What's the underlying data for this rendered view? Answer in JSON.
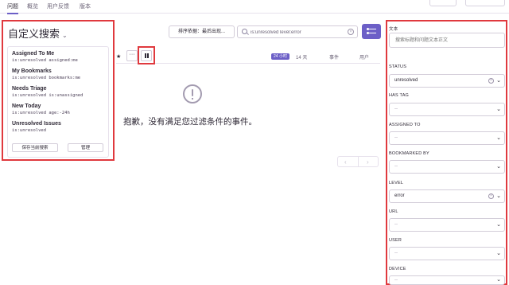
{
  "tabs": [
    {
      "label": "问题",
      "active": true
    },
    {
      "label": "概览",
      "active": false
    },
    {
      "label": "用户反馈",
      "active": false
    },
    {
      "label": "版本",
      "active": false
    }
  ],
  "saved_searches": {
    "title": "自定义搜索",
    "items": [
      {
        "name": "Assigned To Me",
        "query": "is:unresolved assigned:me"
      },
      {
        "name": "My Bookmarks",
        "query": "is:unresolved bookmarks:me"
      },
      {
        "name": "Needs Triage",
        "query": "is:unresolved is:unassigned"
      },
      {
        "name": "New Today",
        "query": "is:unresolved age:-24h"
      },
      {
        "name": "Unresolved Issues",
        "query": "is:unresolved"
      }
    ],
    "save_label": "保存当前搜索",
    "manage_label": "管理"
  },
  "toolbar": {
    "sort_label": "排序依据：最后出现...",
    "search_value": "is:unresolved level:error",
    "accent": "#6c5fc7"
  },
  "stream": {
    "period_label": "24 小时",
    "period_alt": "14 天",
    "col_events": "事件",
    "col_users": "用户",
    "empty_message": "抱歉，没有满足您过滤条件的事件。"
  },
  "sidebar": {
    "text_label": "文本",
    "text_placeholder": "搜索标题和问题文本正文",
    "filters": [
      {
        "label": "STATUS",
        "value": "unresolved",
        "clearable": true
      },
      {
        "label": "HAS TAG",
        "value": "--",
        "clearable": false
      },
      {
        "label": "ASSIGNED TO",
        "value": "--",
        "clearable": false
      },
      {
        "label": "BOOKMARKED BY",
        "value": "--",
        "clearable": false
      },
      {
        "label": "LEVEL",
        "value": "error",
        "clearable": true
      },
      {
        "label": "URL",
        "value": "--",
        "clearable": false
      },
      {
        "label": "USER",
        "value": "--",
        "clearable": false
      },
      {
        "label": "DEVICE",
        "value": "--",
        "clearable": false
      }
    ]
  },
  "highlight_color": "#e0393e"
}
